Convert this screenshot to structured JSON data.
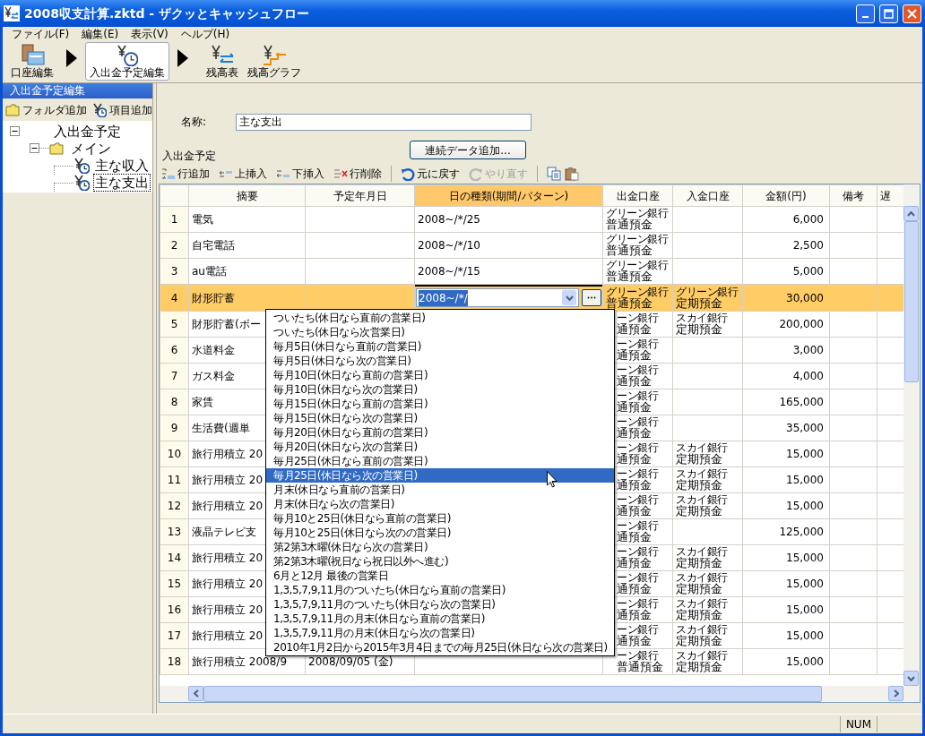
{
  "window": {
    "title": "2008収支計算.zktd - ザクッとキャッシュフロー"
  },
  "menu": [
    {
      "label": "ファイル(F)"
    },
    {
      "label": "編集(E)"
    },
    {
      "label": "表示(V)"
    },
    {
      "label": "ヘルプ(H)"
    }
  ],
  "toolbar": [
    {
      "kind": "button",
      "label": "口座編集",
      "selected": false
    },
    {
      "kind": "arrow"
    },
    {
      "kind": "button",
      "label": "入出金予定編集",
      "selected": true
    },
    {
      "kind": "arrow"
    },
    {
      "kind": "button",
      "label": "残高表",
      "selected": false
    },
    {
      "kind": "button",
      "label": "残高グラフ",
      "selected": false
    }
  ],
  "sidebar": {
    "title": "入出金予定編集",
    "actions": [
      {
        "label": "フォルダ追加"
      },
      {
        "label": "項目追加"
      }
    ],
    "tree": [
      {
        "kind": "root",
        "label": "入出金予定",
        "expanded": true,
        "selected": false,
        "children": [
          {
            "kind": "folder",
            "label": "メイン",
            "expanded": true,
            "selected": false,
            "children": [
              {
                "kind": "item",
                "label": "主な収入",
                "selected": false
              },
              {
                "kind": "item",
                "label": "主な支出",
                "selected": true
              }
            ]
          }
        ]
      }
    ]
  },
  "form": {
    "name_label": "名称:",
    "name_value": "主な支出",
    "section_label": "入出金予定",
    "add_button": "連続データ追加..."
  },
  "grid_toolbar": [
    {
      "kind": "button",
      "label": "行追加",
      "disabled": false
    },
    {
      "kind": "button",
      "label": "上挿入",
      "disabled": false
    },
    {
      "kind": "button",
      "label": "下挿入",
      "disabled": false
    },
    {
      "kind": "button",
      "label": "行削除",
      "disabled": false
    },
    {
      "kind": "separator"
    },
    {
      "kind": "button",
      "label": "元に戻す",
      "disabled": false
    },
    {
      "kind": "button",
      "label": "やり直す",
      "disabled": true
    },
    {
      "kind": "separator"
    },
    {
      "kind": "icon",
      "disabled": false
    },
    {
      "kind": "icon",
      "disabled": false
    }
  ],
  "table": {
    "columns": [
      {
        "label": "摘要",
        "selected": false
      },
      {
        "label": "予定年月日",
        "selected": false
      },
      {
        "label": "日の種類(期間/パターン)",
        "selected": true
      },
      {
        "label": "出金口座",
        "selected": false
      },
      {
        "label": "入金口座",
        "selected": false
      },
      {
        "label": "金額(円)",
        "selected": false
      },
      {
        "label": "備考",
        "selected": false
      },
      {
        "label": "遅",
        "selected": false
      }
    ],
    "rows": [
      {
        "number": "1",
        "summary": "電気",
        "pattern": "2008~/*/25",
        "out_bank": "グリーン銀行",
        "out_type": "普通預金",
        "amount": "6,000",
        "selected": false
      },
      {
        "number": "2",
        "summary": "自宅電話",
        "pattern": "2008~/*/10",
        "out_bank": "グリーン銀行",
        "out_type": "普通預金",
        "amount": "2,500",
        "selected": false
      },
      {
        "number": "3",
        "summary": "au電話",
        "pattern": "2008~/*/15",
        "out_bank": "グリーン銀行",
        "out_type": "普通預金",
        "amount": "5,000",
        "selected": false
      },
      {
        "number": "4",
        "summary": "財形貯蓄",
        "pattern": "2008~/*/",
        "editing": true,
        "out_bank": "グリーン銀行",
        "out_type": "普通預金",
        "in_bank": "グリーン銀行",
        "in_type": "定期預金",
        "amount": "30,000",
        "selected": true
      },
      {
        "number": "5",
        "summary": "財形貯蓄(ボー",
        "out_bank": "ーン銀行",
        "out_type": "通預金",
        "in_bank": "スカイ銀行",
        "in_type": "定期預金",
        "amount": "200,000",
        "selected": false
      },
      {
        "number": "6",
        "summary": "水道料金",
        "out_bank": "ーン銀行",
        "out_type": "通預金",
        "amount": "3,000",
        "selected": false
      },
      {
        "number": "7",
        "summary": "ガス料金",
        "out_bank": "ーン銀行",
        "out_type": "通預金",
        "amount": "4,000",
        "selected": false
      },
      {
        "number": "8",
        "summary": "家賃",
        "out_bank": "ーン銀行",
        "out_type": "通預金",
        "amount": "165,000",
        "selected": false
      },
      {
        "number": "9",
        "summary": "生活費(週単",
        "out_bank": "ーン銀行",
        "out_type": "通預金",
        "amount": "35,000",
        "selected": false
      },
      {
        "number": "10",
        "summary": "旅行用積立 20",
        "out_bank": "ーン銀行",
        "out_type": "通預金",
        "in_bank": "スカイ銀行",
        "in_type": "定期預金",
        "amount": "15,000",
        "selected": false
      },
      {
        "number": "11",
        "summary": "旅行用積立 20",
        "out_bank": "ーン銀行",
        "out_type": "通預金",
        "in_bank": "スカイ銀行",
        "in_type": "定期預金",
        "amount": "15,000",
        "selected": false
      },
      {
        "number": "12",
        "summary": "旅行用積立 20",
        "out_bank": "ーン銀行",
        "out_type": "通預金",
        "in_bank": "スカイ銀行",
        "in_type": "定期預金",
        "amount": "15,000",
        "selected": false
      },
      {
        "number": "13",
        "summary": "液晶テレビ支",
        "out_bank": "ーン銀行",
        "out_type": "通預金",
        "amount": "125,000",
        "selected": false
      },
      {
        "number": "14",
        "summary": "旅行用積立 20",
        "out_bank": "ーン銀行",
        "out_type": "通預金",
        "in_bank": "スカイ銀行",
        "in_type": "定期預金",
        "amount": "15,000",
        "selected": false
      },
      {
        "number": "15",
        "summary": "旅行用積立 20",
        "out_bank": "ーン銀行",
        "out_type": "通預金",
        "in_bank": "スカイ銀行",
        "in_type": "定期預金",
        "amount": "15,000",
        "selected": false
      },
      {
        "number": "16",
        "summary": "旅行用積立 20",
        "out_bank": "ーン銀行",
        "out_type": "通預金",
        "in_bank": "スカイ銀行",
        "in_type": "定期預金",
        "amount": "15,000",
        "selected": false
      },
      {
        "number": "17",
        "summary": "旅行用積立 20",
        "out_bank": "ーン銀行",
        "out_type": "通預金",
        "in_bank": "スカイ銀行",
        "in_type": "定期預金",
        "amount": "15,000",
        "selected": false
      },
      {
        "number": "18",
        "summary": "旅行用積立 2008/9",
        "date": "2008/09/05 (金)",
        "out_bank": "ーン銀行",
        "out_type": "普通預金",
        "in_bank": "スカイ銀行",
        "in_type": "定期預金",
        "amount": "15,000",
        "selected": false
      }
    ]
  },
  "dropdown": {
    "items": [
      {
        "label": "ついたち(休日なら直前の営業日)",
        "selected": false
      },
      {
        "label": "ついたち(休日なら次営業日)",
        "selected": false
      },
      {
        "label": "毎月5日(休日なら直前の営業日)",
        "selected": false
      },
      {
        "label": "毎月5日(休日なら次の営業日)",
        "selected": false
      },
      {
        "label": "毎月10日(休日なら直前の営業日)",
        "selected": false
      },
      {
        "label": "毎月10日(休日なら次の営業日)",
        "selected": false
      },
      {
        "label": "毎月15日(休日なら直前の営業日)",
        "selected": false
      },
      {
        "label": "毎月15日(休日なら次の営業日)",
        "selected": false
      },
      {
        "label": "毎月20日(休日なら直前の営業日)",
        "selected": false
      },
      {
        "label": "毎月20日(休日なら次の営業日)",
        "selected": false
      },
      {
        "label": "毎月25日(休日なら直前の営業日)",
        "selected": false
      },
      {
        "label": "毎月25日(休日なら次の営業日)",
        "selected": true
      },
      {
        "label": "月末(休日なら直前の営業日)",
        "selected": false
      },
      {
        "label": "月末(休日なら次の営業日)",
        "selected": false
      },
      {
        "label": "毎月10と25日(休日なら直前の営業日)",
        "selected": false
      },
      {
        "label": "毎月10と25日(休日なら次のの営業日)",
        "selected": false
      },
      {
        "label": "第2第3木曜(休日なら次の営業日)",
        "selected": false
      },
      {
        "label": "第2第3木曜(祝日なら祝日以外へ進む)",
        "selected": false
      },
      {
        "label": "6月と12月 最後の営業日",
        "selected": false
      },
      {
        "label": "1,3,5,7,9,11月のついたち(休日なら直前の営業日)",
        "selected": false
      },
      {
        "label": "1,3,5,7,9,11月のついたち(休日なら次の営業日)",
        "selected": false
      },
      {
        "label": "1,3,5,7,9,11月の月末(休日なら直前の営業日)",
        "selected": false
      },
      {
        "label": "1,3,5,7,9,11月の月末(休日なら次の営業日)",
        "selected": false
      },
      {
        "label": "2010年1月2日から2015年3月4日までの毎月25日(休日なら次の営業日)",
        "selected": false
      }
    ]
  },
  "status_bar": {
    "panels": [
      "NUM"
    ]
  }
}
